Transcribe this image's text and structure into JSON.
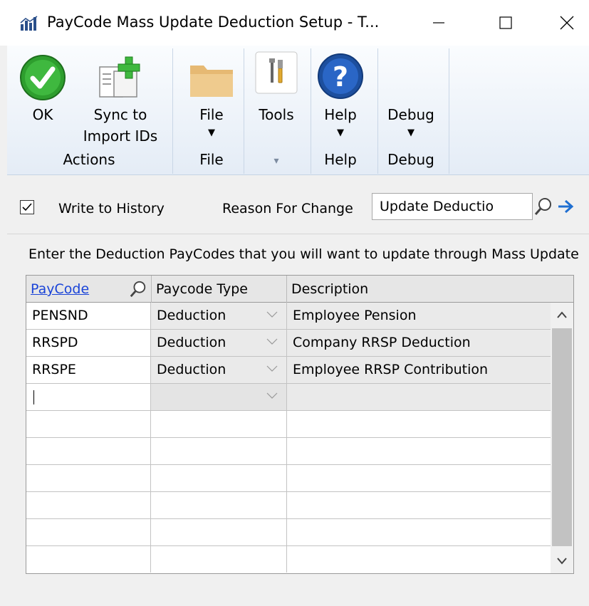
{
  "window": {
    "title": "PayCode Mass Update Deduction Setup  -  T...",
    "minimize_glyph": "—",
    "maximize_glyph": "☐",
    "close_glyph": "✕"
  },
  "ribbon": {
    "ok": {
      "label": "OK",
      "icon": "check-icon"
    },
    "sync": {
      "label_line1": "Sync to",
      "label_line2": "Import IDs",
      "icon": "sync-import-icon"
    },
    "actions_group": "Actions",
    "file": {
      "label": "File",
      "arrow": "▼",
      "icon": "folder-icon"
    },
    "file_group": "File",
    "tools": {
      "label": "Tools",
      "icon": "tools-icon"
    },
    "tools_group": "▾",
    "help": {
      "label": "Help",
      "arrow": "▼",
      "icon": "help-icon"
    },
    "help_group": "Help",
    "debug": {
      "label": "Debug",
      "arrow": "▼"
    },
    "debug_group": "Debug"
  },
  "options": {
    "write_history_checked": true,
    "write_history_label": "Write to History",
    "reason_label": "Reason For Change",
    "reason_value": "Update Deductio"
  },
  "instruction": "Enter the Deduction PayCodes that you will want to update through Mass Update",
  "grid": {
    "columns": [
      "PayCode",
      "Paycode Type",
      "Description"
    ],
    "rows": [
      {
        "paycode": "PENSND",
        "type": "Deduction",
        "description": "Employee Pension"
      },
      {
        "paycode": "RRSPD",
        "type": "Deduction",
        "description": "Company RRSP Deduction"
      },
      {
        "paycode": "RRSPE",
        "type": "Deduction",
        "description": "Employee RRSP Contribution"
      }
    ]
  },
  "colors": {
    "accent_link": "#1a44d8",
    "ok_green": "#2e9e2e",
    "help_blue": "#2a5fb8",
    "ribbon_top": "#fafcfe",
    "ribbon_bottom": "#e4ecf6"
  }
}
